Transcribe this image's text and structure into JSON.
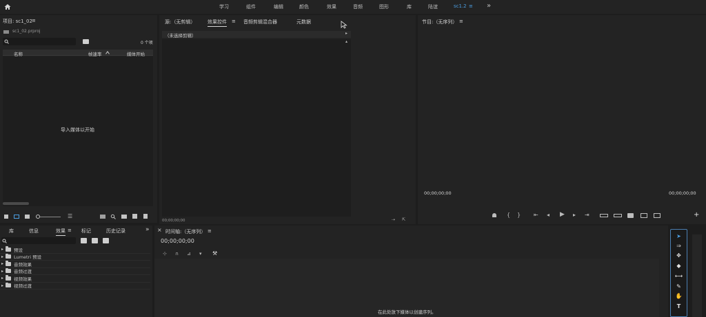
{
  "workspaces": [
    {
      "label": "学习",
      "active": false
    },
    {
      "label": "组件",
      "active": false
    },
    {
      "label": "编辑",
      "active": false
    },
    {
      "label": "颜色",
      "active": false
    },
    {
      "label": "效果",
      "active": false
    },
    {
      "label": "音频",
      "active": false
    },
    {
      "label": "图形",
      "active": false
    },
    {
      "label": "库",
      "active": false
    },
    {
      "label": "陆谊",
      "active": false
    },
    {
      "label": "sc1.2",
      "active": true
    }
  ],
  "workspace_menu_icon": "≡",
  "more_icon": "»",
  "home_icon": "home-icon",
  "project_panel": {
    "title": "项目: sc1_02",
    "menu_icon": "≡",
    "file_name": "sc1_02.prproj",
    "search_placeholder": "",
    "item_count": "0 个项",
    "columns": [
      "名称",
      "帧速率",
      "媒体开始"
    ],
    "empty_message": "导入媒体以开始"
  },
  "source_panel": {
    "tabs": [
      {
        "label": "源:（无剪辑）",
        "active": false
      },
      {
        "label": "效果控件",
        "active": true
      },
      {
        "label": "音频剪辑混合器",
        "active": false
      },
      {
        "label": "元数据",
        "active": false
      }
    ],
    "menu_icon": "≡",
    "no_clip_label": "（未选择剪辑）",
    "timecode": "00;00;00;00"
  },
  "program_monitor": {
    "title": "节目:（无序列）",
    "menu_icon": "≡",
    "timecode_left": "00;00;00;00",
    "timecode_right": "00;00;00;00"
  },
  "effects_panel": {
    "tabs": [
      {
        "label": "库",
        "active": false
      },
      {
        "label": "信息",
        "active": false
      },
      {
        "label": "效果",
        "active": true
      },
      {
        "label": "标记",
        "active": false
      },
      {
        "label": "历史记录",
        "active": false
      }
    ],
    "menu_icon": "≡",
    "more_icon": "»",
    "tree": [
      "预设",
      "Lumetri 预设",
      "音频效果",
      "音频过渡",
      "视频效果",
      "视频过渡"
    ]
  },
  "timeline_panel": {
    "title": "时间轴:（无序列）",
    "menu_icon": "≡",
    "close_icon": "×",
    "timecode": "00;00;00;00",
    "empty_message": "在此处放下媒体以创建序列。"
  },
  "add_button": "+"
}
